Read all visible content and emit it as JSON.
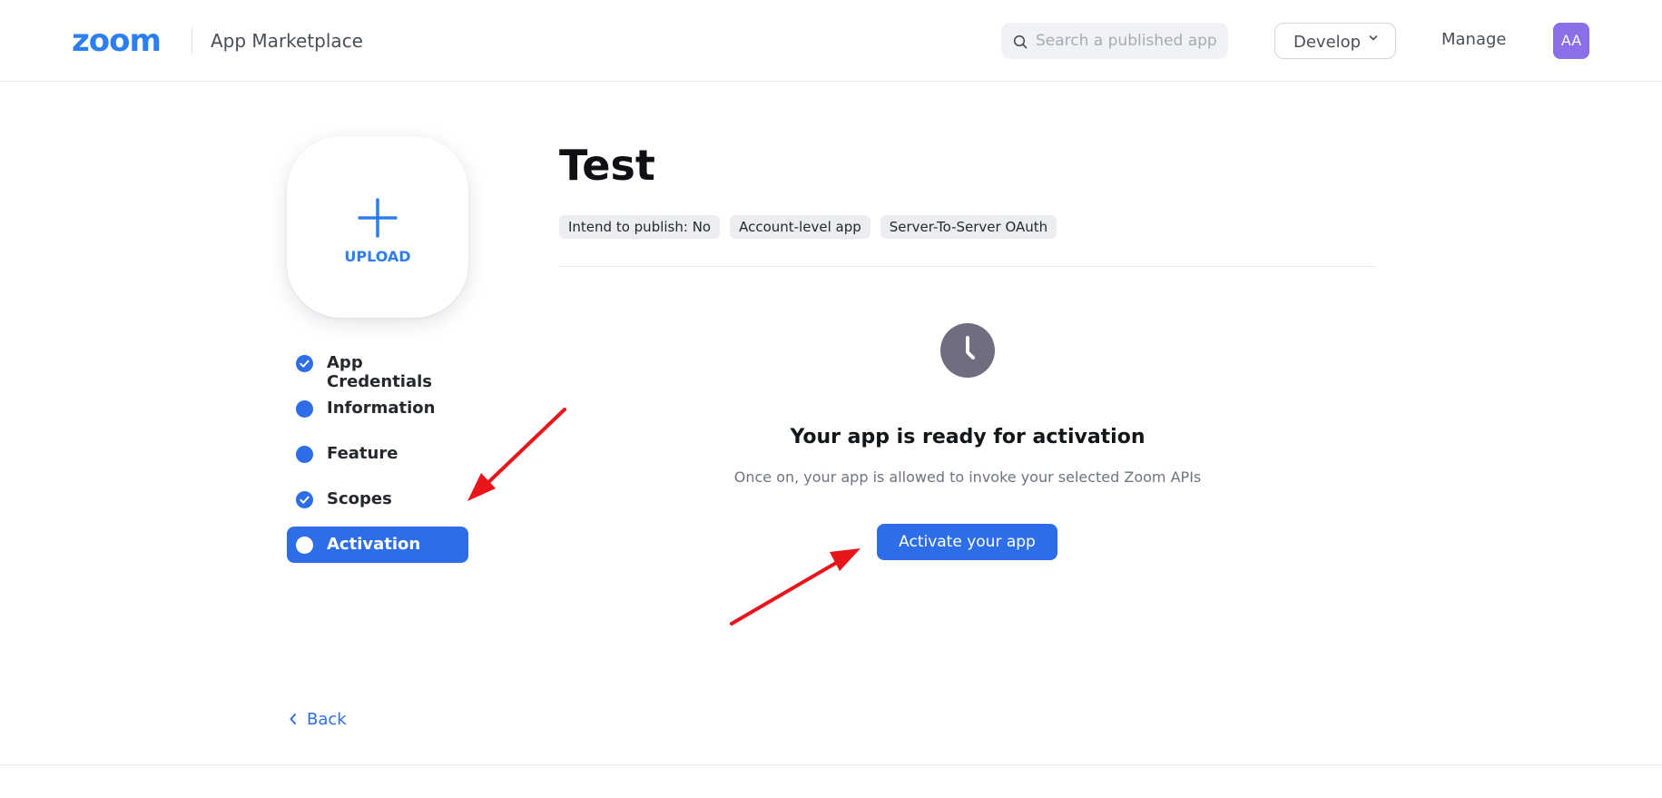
{
  "header": {
    "logo_text": "zoom",
    "title": "App Marketplace",
    "search_placeholder": "Search a published app",
    "develop_label": "Develop",
    "manage_label": "Manage",
    "avatar_initials": "AA",
    "brand_color": "#2d7ff0",
    "avatar_color": "#8a6fe8"
  },
  "upload": {
    "label": "UPLOAD"
  },
  "steps": [
    {
      "label": "App Credentials",
      "state": "completed"
    },
    {
      "label": "Information",
      "state": "in-progress"
    },
    {
      "label": "Feature",
      "state": "in-progress"
    },
    {
      "label": "Scopes",
      "state": "completed"
    },
    {
      "label": "Activation",
      "state": "active"
    }
  ],
  "app": {
    "name": "Test",
    "tags": [
      "Intend to publish: No",
      "Account-level app",
      "Server-To-Server OAuth"
    ]
  },
  "activation": {
    "status_icon": "clock-icon",
    "title": "Your app is ready for activation",
    "subtitle": "Once on, your app is allowed to invoke your selected Zoom APIs",
    "button_label": "Activate your app",
    "accent_color": "#2d6ee8"
  },
  "footer": {
    "back_label": "Back"
  },
  "annotations": {
    "arrow_color": "#e8151b"
  }
}
